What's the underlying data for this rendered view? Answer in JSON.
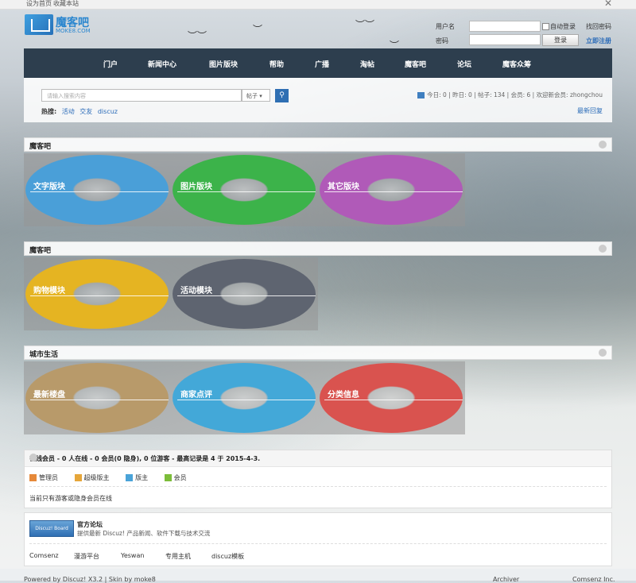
{
  "topbar": {
    "set_home": "设为首页",
    "bookmark": "收藏本站",
    "close": "✕"
  },
  "logo": {
    "cn": "魔客吧",
    "en": "MOKE8.COM"
  },
  "login": {
    "username_label": "用户名",
    "password_label": "密码",
    "auto_login": "自动登录",
    "forgot": "找回密码",
    "login_button": "登录",
    "register": "立即注册"
  },
  "nav": {
    "items": [
      "门户",
      "新闻中心",
      "图片版块",
      "帮助",
      "广播",
      "淘帖",
      "魔客吧",
      "论坛",
      "魔客众筹"
    ]
  },
  "search": {
    "placeholder": "请输入搜索内容",
    "scope": "帖子",
    "hot_label": "热搜:",
    "hot": [
      "活动",
      "交友",
      "discuz"
    ],
    "stats": "今日: 0 | 昨日: 0 | 帖子: 134 | 会员: 6 | 欢迎新会员: zhongchou",
    "latest_reply": "最新回复"
  },
  "sections": [
    {
      "title": "魔客吧",
      "tiles": [
        {
          "label": "文字版块",
          "color": "#4a9fd8"
        },
        {
          "label": "图片版块",
          "color": "#3cb34a"
        },
        {
          "label": "其它版块",
          "color": "#b05ab8"
        }
      ]
    },
    {
      "title": "魔客吧",
      "tiles": [
        {
          "label": "购物模块",
          "color": "#e5b422"
        },
        {
          "label": "活动模块",
          "color": "#5e6470"
        }
      ]
    },
    {
      "title": "城市生活",
      "tiles": [
        {
          "label": "最新楼盘",
          "color": "#b89a6a"
        },
        {
          "label": "商家点评",
          "color": "#43a8d8"
        },
        {
          "label": "分类信息",
          "color": "#d9534f"
        }
      ]
    }
  ],
  "online": {
    "title": "在线会员 - 0 人在线 - 0 会员(0 隐身), 0 位游客 - 最高记录是 4 于 2015-4-3.",
    "legend": [
      {
        "label": "管理员",
        "color": "#e6893a"
      },
      {
        "label": "超级版主",
        "color": "#e6a63a"
      },
      {
        "label": "版主",
        "color": "#4aa3d8"
      },
      {
        "label": "会员",
        "color": "#7cbd3a"
      }
    ],
    "note": "当前只有游客或隐身会员在线"
  },
  "links": {
    "badge": "Discuz! Board",
    "title": "官方论坛",
    "desc": "提供最新 Discuz! 产品新闻、软件下载与技术交流",
    "friends": [
      "Comsenz",
      "漫游平台",
      "Yeswan",
      "专用主机",
      "discuz模板"
    ]
  },
  "footer": {
    "powered": "Powered by Discuz! X3.2 | Skin by moke8",
    "archiver": "Archiver",
    "company": "Comsenz Inc."
  }
}
